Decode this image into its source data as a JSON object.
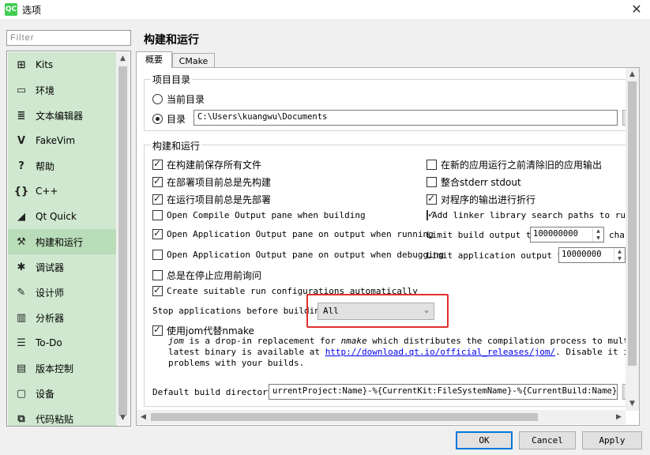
{
  "window": {
    "app_icon_text": "QC",
    "title": "选项",
    "close_glyph": "✕"
  },
  "filter": {
    "placeholder": "Filter"
  },
  "sidebar": {
    "items": [
      {
        "label": "Kits",
        "icon": "kits-icon",
        "glyph": "⊞"
      },
      {
        "label": "环境",
        "icon": "monitor-icon",
        "glyph": "▭"
      },
      {
        "label": "文本编辑器",
        "icon": "text-editor-icon",
        "glyph": "≣"
      },
      {
        "label": "FakeVim",
        "icon": "fakevim-icon",
        "glyph": "V"
      },
      {
        "label": "帮助",
        "icon": "help-icon",
        "glyph": "?"
      },
      {
        "label": "C++",
        "icon": "cpp-braces-icon",
        "glyph": "{}"
      },
      {
        "label": "Qt Quick",
        "icon": "qt-quick-icon",
        "glyph": "◢"
      },
      {
        "label": "构建和运行",
        "icon": "hammer-icon",
        "glyph": "⚒",
        "active": true
      },
      {
        "label": "调试器",
        "icon": "bug-icon",
        "glyph": "✱"
      },
      {
        "label": "设计师",
        "icon": "pencil-icon",
        "glyph": "✎"
      },
      {
        "label": "分析器",
        "icon": "analyzer-icon",
        "glyph": "▥"
      },
      {
        "label": "To-Do",
        "icon": "todo-list-icon",
        "glyph": "☰"
      },
      {
        "label": "版本控制",
        "icon": "version-control-icon",
        "glyph": "▤"
      },
      {
        "label": "设备",
        "icon": "device-icon",
        "glyph": "▢"
      },
      {
        "label": "代码粘贴",
        "icon": "code-paste-icon",
        "glyph": "⧉"
      }
    ]
  },
  "page": {
    "title": "构建和运行",
    "tabs": [
      {
        "label": "概要"
      },
      {
        "label": "CMake"
      }
    ]
  },
  "project_dir": {
    "group_title": "项目目录",
    "current_dir_label": "当前目录",
    "dir_label": "目录",
    "dir_value": "C:\\Users\\kuangwu\\Documents",
    "selected": "目录"
  },
  "build_run": {
    "group_title": "构建和运行",
    "left_options": [
      {
        "label": "在构建前保存所有文件",
        "checked": true
      },
      {
        "label": "在部署项目前总是先构建",
        "checked": true
      },
      {
        "label": "在运行项目前总是先部署",
        "checked": true
      },
      {
        "label": "Open Compile Output pane when building",
        "checked": false
      },
      {
        "label": "Open Application Output pane on output when running",
        "checked": true
      },
      {
        "label": "Open Application Output pane on output when debugging",
        "checked": false
      },
      {
        "label": "总是在停止应用前询问",
        "checked": false
      },
      {
        "label": "Create suitable run configurations automatically",
        "checked": true
      }
    ],
    "right_options": [
      {
        "label": "在新的应用运行之前清除旧的应用输出",
        "checked": false
      },
      {
        "label": "整合stderr stdout",
        "checked": false
      },
      {
        "label": "对程序的输出进行折行",
        "checked": true
      },
      {
        "label": "Add linker library search paths to run",
        "checked": true
      }
    ],
    "limit_build_label": "Limit build output to",
    "limit_build_value": "100000000",
    "limit_build_unit": "char",
    "limit_app_label": "Limit application output to",
    "limit_app_value": "10000000",
    "stop_apps_label": "Stop applications before building:",
    "stop_apps_value": "All",
    "jom": {
      "label": "使用jom代替nmake",
      "checked": true,
      "desc_line1_prefix": "jom",
      "desc_line1_rest": " is a drop-in replacement for ",
      "desc_line1_nmake": "nmake",
      "desc_line1_end": " which distributes the compilation process to multiple CPU",
      "desc_line2_prefix": "latest binary is available at ",
      "desc_link": "http://download.qt.io/official_releases/jom/",
      "desc_line2_end": ". Disable it if you exp",
      "desc_line3": "problems with your builds."
    },
    "default_build_dir_label": "Default build directory:",
    "default_build_dir_value": "urrentProject:Name}-%{CurrentKit:FileSystemName}-%{CurrentBuild:Name}\")}"
  },
  "buttons": {
    "ok": "OK",
    "cancel": "Cancel",
    "apply": "Apply"
  },
  "colors": {
    "sidebar_bg": "#cfe8cf",
    "highlight_border": "#e0302e",
    "link": "#0000ee"
  }
}
